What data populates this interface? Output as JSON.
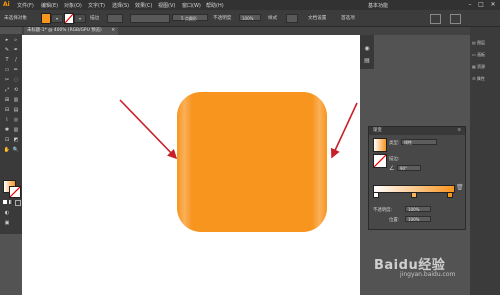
{
  "app": {
    "logo": "Ai"
  },
  "menu": [
    "文件(F)",
    "编辑(E)",
    "对象(O)",
    "文字(T)",
    "选择(S)",
    "效果(C)",
    "视图(V)",
    "窗口(W)",
    "帮助(H)"
  ],
  "window_controls": {
    "workspace": "基本功能",
    "minimize": "–",
    "maximize": "□",
    "close": "✕"
  },
  "controlbar": {
    "selection": "未选择对象",
    "stroke_label": "描边",
    "points_label": "5 点圆形",
    "opacity_label": "不透明度",
    "opacity_value": "100%",
    "style_label": "样式",
    "doc_setup": "文档设置",
    "prefs": "首选项"
  },
  "document": {
    "tab_title": "未标题-1* @ 400% (RGB/GPU 预览)",
    "close": "✕"
  },
  "tools": [
    "▸",
    "▹",
    "✎",
    "✒",
    "T",
    "/",
    "▭",
    "✏",
    "✂",
    "◌",
    "⤢",
    "⟲",
    "⊞",
    "▥",
    "✋",
    "🔍"
  ],
  "right_column": [
    "图层",
    "画板",
    "资源",
    "属性"
  ],
  "gradient_panel": {
    "title": "渐变",
    "type_label": "类型:",
    "type_value": "线性",
    "stroke_label": "描边:",
    "angle_value": "90°",
    "opacity_label": "不透明度:",
    "opacity_value": "100%",
    "location_label": "位置:",
    "location_value": "100%"
  },
  "watermark": {
    "text": "Baidu经验",
    "url": "jingyan.baidu.com"
  },
  "colors": {
    "shape_fill": "#f7951f",
    "arrow": "#c8202a",
    "ui_dark": "#323232",
    "canvas": "#ffffff"
  }
}
